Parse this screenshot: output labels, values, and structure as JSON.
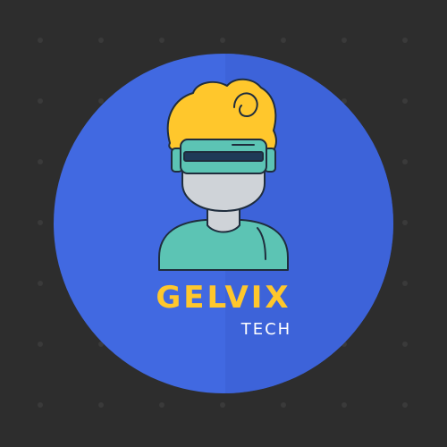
{
  "logo": {
    "brand_name": "GELVIX",
    "tagline": "TECH"
  },
  "colors": {
    "background": "#2d2d2d",
    "dot": "#3a3a3a",
    "circle_main": "#4169e1",
    "circle_shade": "#3a5fd4",
    "hair": "#ffc72c",
    "goggles": "#5cc4b4",
    "goggle_strap": "#5cc4b4",
    "goggle_visor": "#1f3a57",
    "face": "#cfd3d8",
    "shirt": "#5cc4b4",
    "outline": "#1f2d3d",
    "brand_name_color": "#ffc72c",
    "tagline_color": "#ffffff"
  },
  "icons": {
    "mascot": "vr-headset-person-icon"
  }
}
